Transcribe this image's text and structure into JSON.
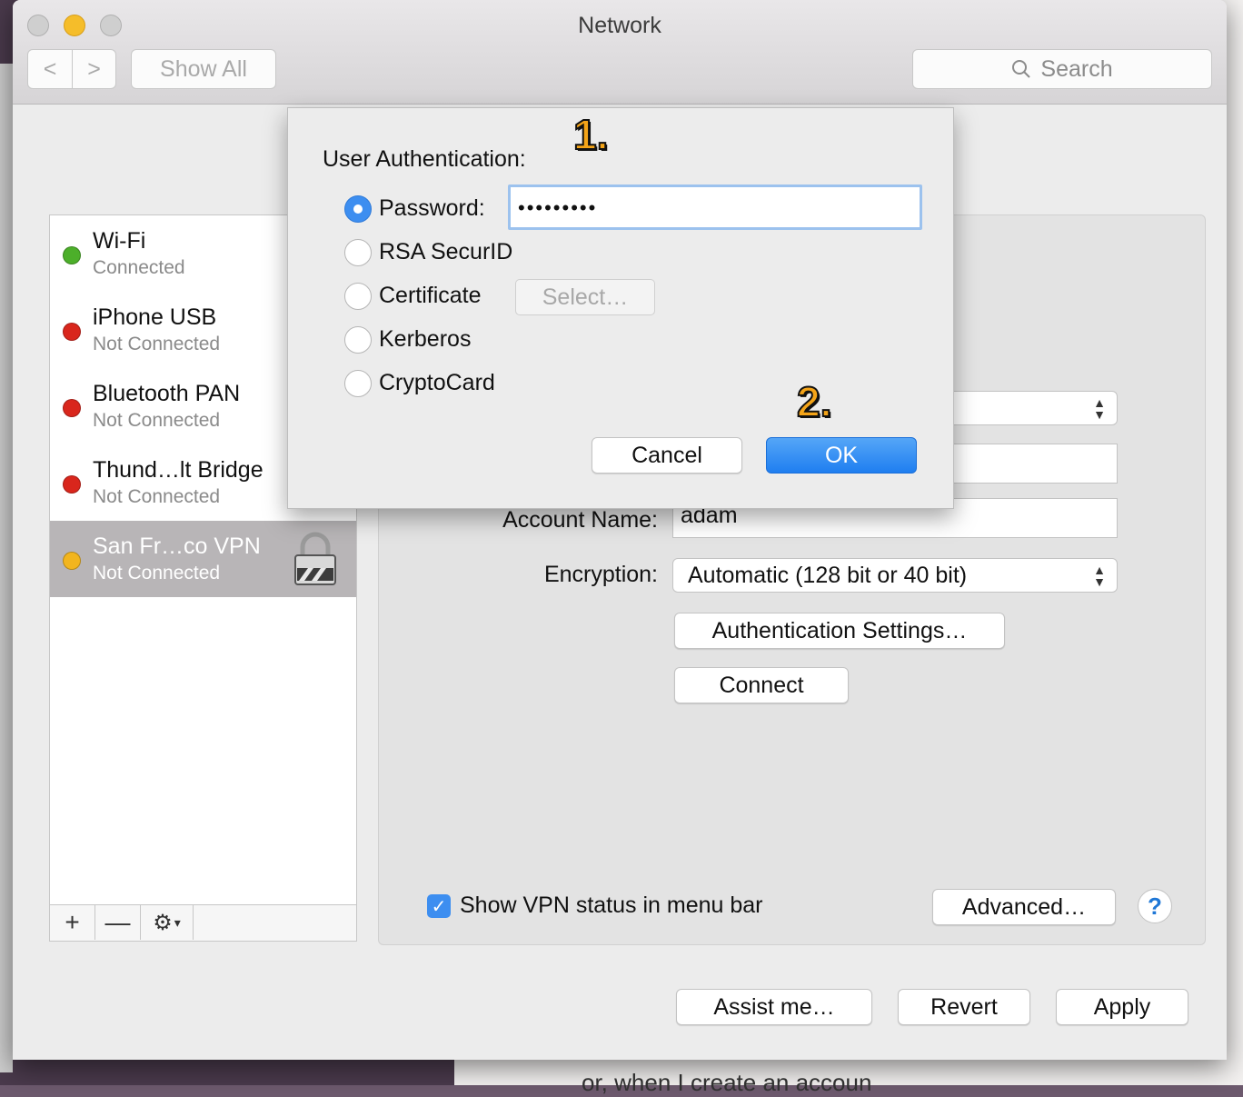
{
  "window": {
    "title": "Network",
    "nav_back": "<",
    "nav_forward": ">",
    "show_all": "Show All",
    "search_placeholder": "Search"
  },
  "services": [
    {
      "name": "Wi-Fi",
      "status": "Connected",
      "dot_color": "#4caf2a"
    },
    {
      "name": "iPhone USB",
      "status": "Not Connected",
      "dot_color": "#d9261c"
    },
    {
      "name": "Bluetooth PAN",
      "status": "Not Connected",
      "dot_color": "#d9261c"
    },
    {
      "name": "Thund…lt Bridge",
      "status": "Not Connected",
      "dot_color": "#d9261c"
    },
    {
      "name": "San Fr…co VPN",
      "status": "Not Connected",
      "dot_color": "#f2b51e",
      "selected": true
    }
  ],
  "sidebar_tools": {
    "add": "+",
    "remove": "—",
    "gear": "⚙"
  },
  "vpn_config": {
    "account_label": "Account Name:",
    "account_value": "adam",
    "encryption_label": "Encryption:",
    "encryption_value": "Automatic (128 bit or 40 bit)",
    "auth_settings": "Authentication Settings…",
    "connect": "Connect",
    "show_status": "Show VPN status in menu bar",
    "advanced": "Advanced…",
    "help": "?"
  },
  "footer": {
    "assist": "Assist me…",
    "revert": "Revert",
    "apply": "Apply"
  },
  "auth_sheet": {
    "title": "User Authentication:",
    "options": [
      "Password:",
      "RSA SecurID",
      "Certificate",
      "Kerberos",
      "CryptoCard"
    ],
    "password_value": "•••••••••",
    "select_button": "Select…",
    "cancel": "Cancel",
    "ok": "OK"
  },
  "annotations": {
    "step1": "1.",
    "step2": "2."
  },
  "background_text": "or, when I create an accoun",
  "colors": {
    "accent": "#3d8ef0",
    "selection": "#b8b5b7",
    "annotation": "#f4a418"
  }
}
